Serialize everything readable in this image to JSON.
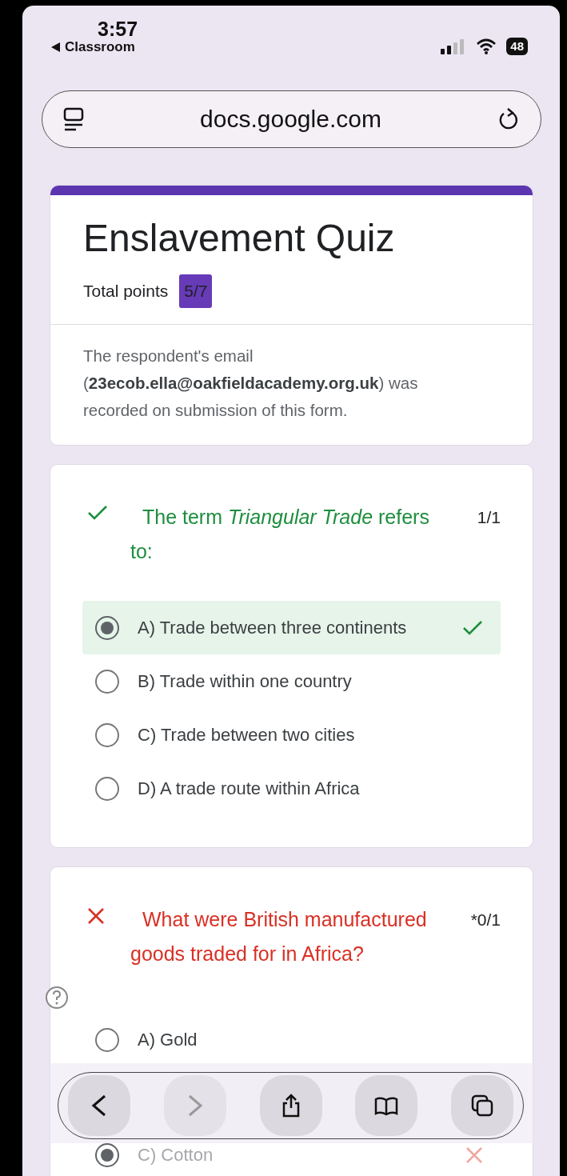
{
  "status_bar": {
    "time": "3:57",
    "back_label": "Classroom",
    "battery": "48"
  },
  "address_bar": {
    "url": "docs.google.com"
  },
  "form": {
    "title": "Enslavement Quiz",
    "total_points_label": "Total points",
    "score": "5/7",
    "email_notice": "The respondent's email (**23ecob.ella@oakfieldacademy.org.uk**) was recorded on submission of this form."
  },
  "questions": [
    {
      "kind": "correct",
      "text": "The term *Triangular Trade* refers to:",
      "points": "1/1",
      "options": [
        {
          "label": "A) Trade between three continents",
          "selected": true,
          "kind": "correct"
        },
        {
          "label": "B) Trade within one country",
          "selected": false,
          "kind": "plain"
        },
        {
          "label": "C) Trade between two cities",
          "selected": false,
          "kind": "plain"
        },
        {
          "label": "D) A trade route within Africa",
          "selected": false,
          "kind": "plain"
        }
      ]
    },
    {
      "kind": "incorrect",
      "text": "What were British manufactured goods traded for in Africa?",
      "points": "*0/1",
      "options": [
        {
          "label": "A) Gold",
          "selected": false,
          "kind": "plain"
        },
        {
          "label": "C) Cotton",
          "selected": true,
          "kind": "incorrect"
        }
      ]
    }
  ],
  "toolbar": [
    {
      "kind": "back",
      "disabled": false
    },
    {
      "kind": "forward",
      "disabled": true
    },
    {
      "kind": "share",
      "disabled": false
    },
    {
      "kind": "bookmarks",
      "disabled": false
    },
    {
      "kind": "tabs",
      "disabled": false
    }
  ]
}
